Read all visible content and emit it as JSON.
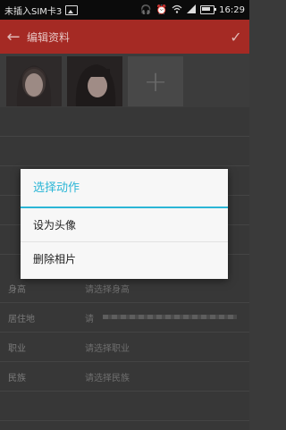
{
  "status_bar": {
    "carrier": "未插入SIM卡3",
    "time": "16:29",
    "icons": [
      "image-icon",
      "headset-icon",
      "alarm-icon",
      "wifi-icon",
      "signal-icon",
      "battery-icon"
    ]
  },
  "app_bar": {
    "title": "编辑资料",
    "back_icon": "←",
    "confirm_icon": "✓",
    "color": "#a52a24"
  },
  "photos": {
    "add_symbol": "+"
  },
  "form": {
    "rows": [
      {
        "label": "身高",
        "value": "请选择身高"
      },
      {
        "label": "居住地",
        "value": "请"
      },
      {
        "label": "职业",
        "value": "请选择职业"
      },
      {
        "label": "民族",
        "value": "请选择民族"
      }
    ]
  },
  "dialog": {
    "title": "选择动作",
    "items": [
      "设为头像",
      "删除相片"
    ],
    "accent": "#2bb6d6"
  }
}
